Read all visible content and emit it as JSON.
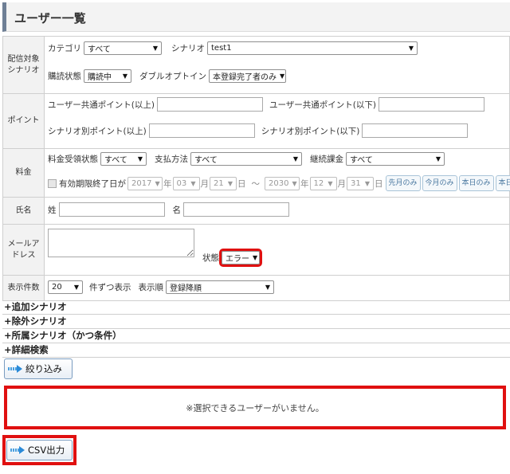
{
  "header": {
    "title": "ユーザー一覧"
  },
  "scenario": {
    "label_line1": "配信対象",
    "label_line2": "シナリオ",
    "category_label": "カテゴリ",
    "category_value": "すべて",
    "scenario_label": "シナリオ",
    "scenario_value": "test1",
    "subscribe_label": "購読状態",
    "subscribe_value": "購読中",
    "double_optin_label": "ダブルオプトイン",
    "double_optin_value": "本登録完了者のみ"
  },
  "points": {
    "label": "ポイント",
    "common_min_label": "ユーザー共通ポイント(以上)",
    "common_max_label": "ユーザー共通ポイント(以下)",
    "scenario_min_label": "シナリオ別ポイント(以上)",
    "scenario_max_label": "シナリオ別ポイント(以下)"
  },
  "fee": {
    "label": "料金",
    "receipt_label": "料金受領状態",
    "receipt_value": "すべて",
    "payment_label": "支払方法",
    "payment_value": "すべて",
    "recurring_label": "継続課金",
    "recurring_value": "すべて",
    "expiry_label": "有効期限終了日が",
    "from_year": "2017",
    "from_month": "03",
    "from_day": "21",
    "to_year": "2030",
    "to_month": "12",
    "to_day": "31",
    "year_unit": "年",
    "month_unit": "月",
    "day_unit": "日",
    "tilde": "～",
    "btn_start_month": "先月のみ",
    "btn_this_month": "今月のみ",
    "btn_today": "本日のみ",
    "btn_after_today": "本日以降"
  },
  "name": {
    "label": "氏名",
    "last_label": "姓",
    "first_label": "名"
  },
  "mail": {
    "label_line1": "メールア",
    "label_line2": "ドレス",
    "status_label": "状態",
    "status_value": "エラー"
  },
  "display": {
    "label": "表示件数",
    "count_value": "20",
    "per_page_label": "件ずつ表示",
    "order_label": "表示順",
    "order_value": "登録降順"
  },
  "sections": [
    "+追加シナリオ",
    "+除外シナリオ",
    "+所属シナリオ（かつ条件）",
    "+詳細検索"
  ],
  "buttons": {
    "filter": "絞り込み",
    "csv": "CSV出力"
  },
  "result": {
    "message": "※選択できるユーザーがいません。"
  }
}
